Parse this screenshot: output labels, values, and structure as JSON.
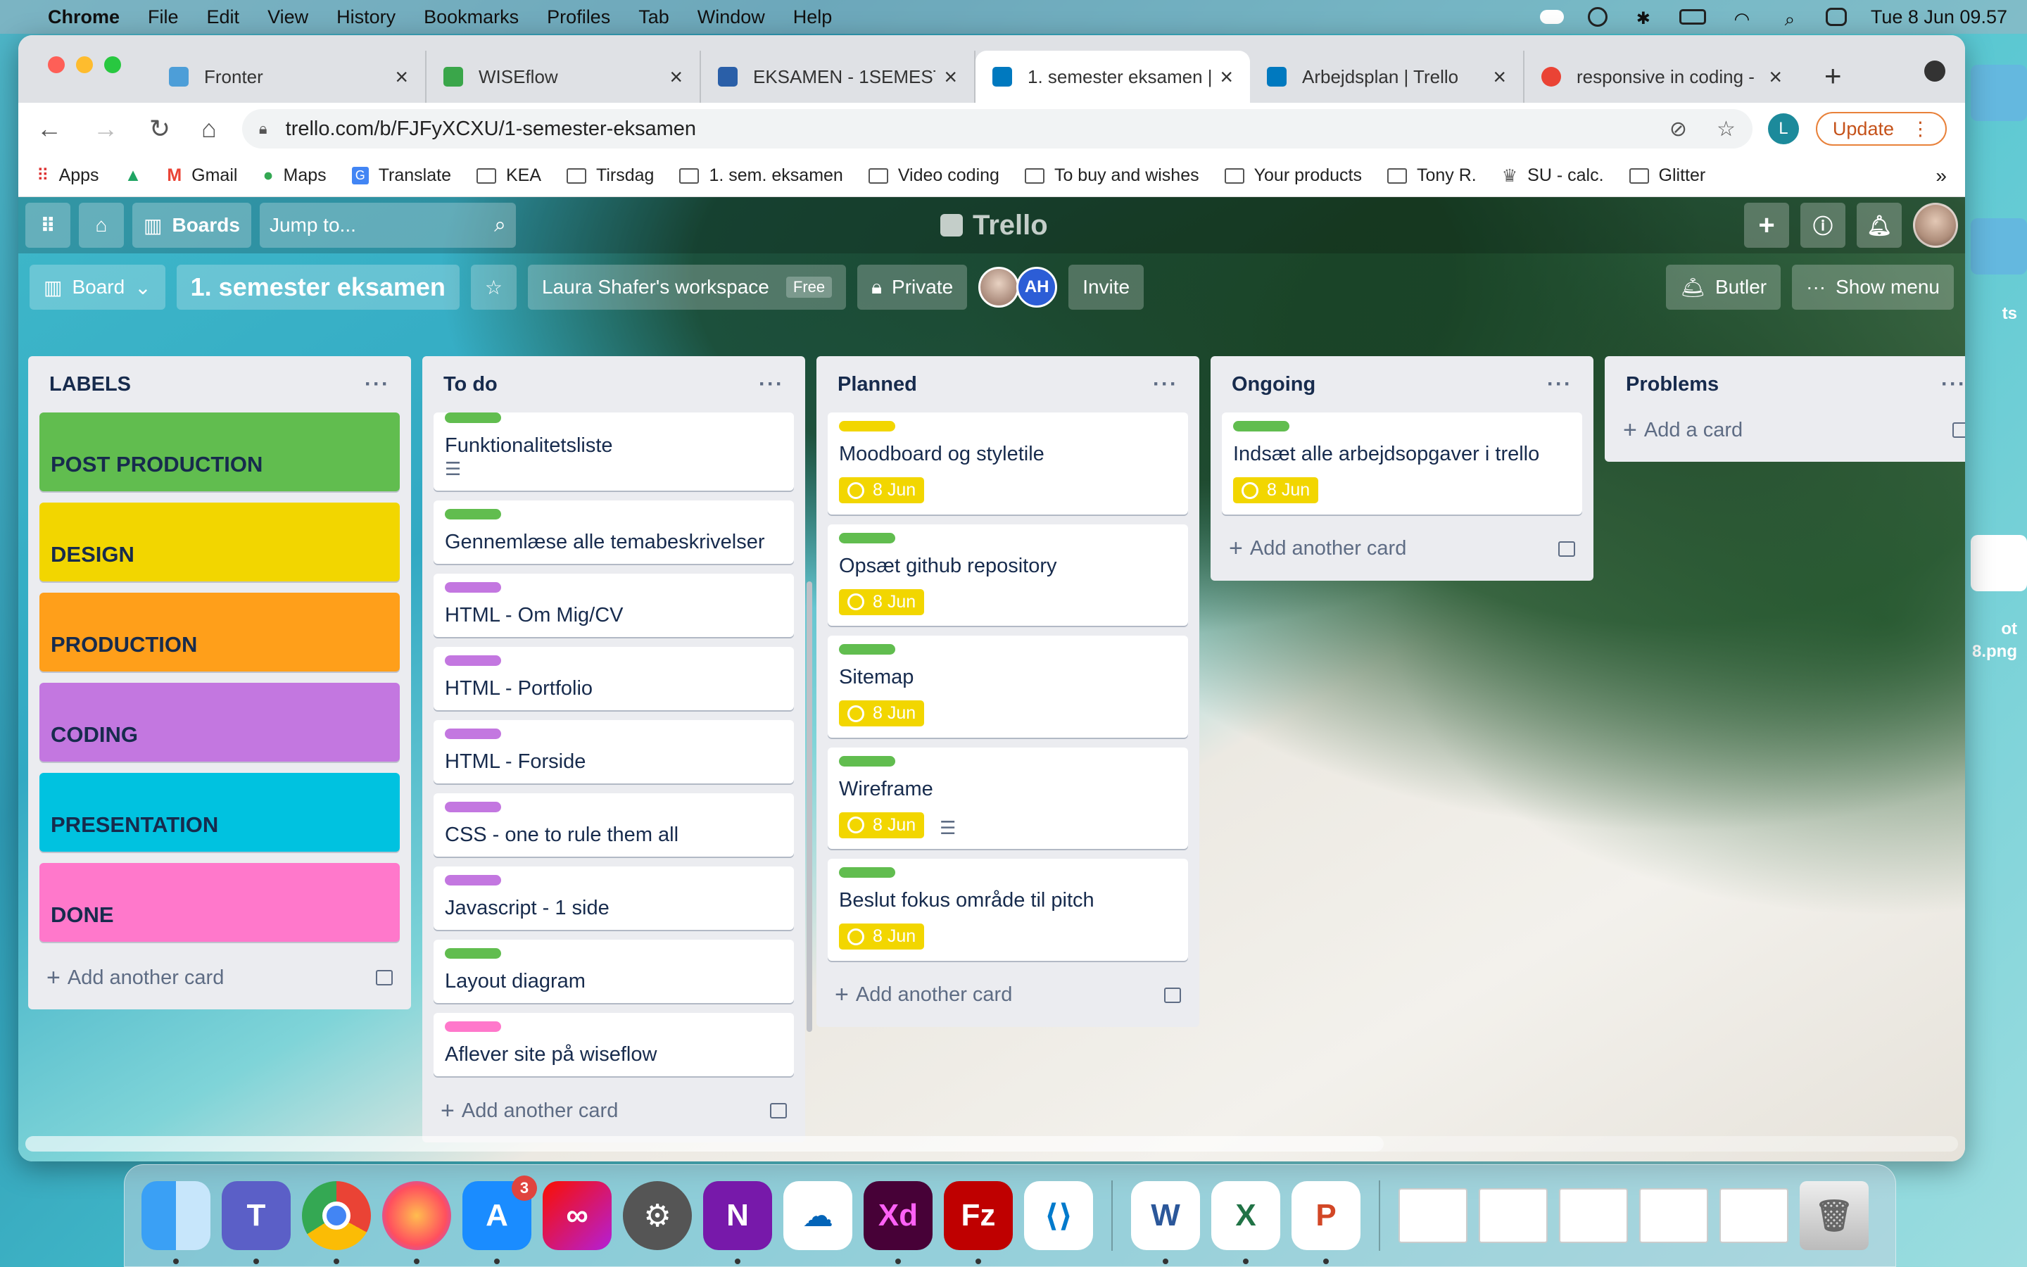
{
  "menubar": {
    "app": "Chrome",
    "items": [
      "File",
      "Edit",
      "View",
      "History",
      "Bookmarks",
      "Profiles",
      "Tab",
      "Window",
      "Help"
    ],
    "clock": "Tue 8 Jun  09.57"
  },
  "tabs": [
    {
      "title": "Fronter",
      "color": "#4d9ed8",
      "active": false
    },
    {
      "title": "WISEflow",
      "color": "#3aa64a",
      "active": false
    },
    {
      "title": "EKSAMEN - 1SEMESTE",
      "color": "#2a5fa8",
      "active": false
    },
    {
      "title": "1. semester eksamen |",
      "color": "#0079bf",
      "active": true
    },
    {
      "title": "Arbejdsplan | Trello",
      "color": "#0079bf",
      "active": false
    },
    {
      "title": "responsive in coding -",
      "color": "#ea4335",
      "active": false
    }
  ],
  "address": {
    "url": "trello.com/b/FJFyXCXU/1-semester-eksamen",
    "profile_initial": "L",
    "update_label": "Update"
  },
  "bookmarks": {
    "items": [
      "Apps",
      "Gmail",
      "Maps",
      "Translate",
      "KEA",
      "Tirsdag",
      "1. sem. eksamen",
      "Video coding",
      "To buy and wishes",
      "Your products",
      "Tony R.",
      "SU - calc.",
      "Glitter"
    ],
    "more": "»"
  },
  "trello": {
    "boards_label": "Boards",
    "jump_placeholder": "Jump to...",
    "logo": "Trello",
    "view_label": "Board",
    "board_title": "1. semester eksamen",
    "workspace": "Laura Shafer's workspace",
    "workspace_badge": "Free",
    "visibility": "Private",
    "member_initials": "AH",
    "invite": "Invite",
    "butler": "Butler",
    "show_menu": "Show menu"
  },
  "lists": {
    "labels": {
      "title": "LABELS",
      "cards": [
        {
          "text": "POST PRODUCTION",
          "color": "#61bd4f"
        },
        {
          "text": "DESIGN",
          "color": "#f2d600"
        },
        {
          "text": "PRODUCTION",
          "color": "#ff9f1a"
        },
        {
          "text": "CODING",
          "color": "#c377e0"
        },
        {
          "text": "PRESENTATION",
          "color": "#00c2e0"
        },
        {
          "text": "DONE",
          "color": "#ff78cb"
        }
      ],
      "add": "Add another card"
    },
    "todo": {
      "title": "To do",
      "cards": [
        {
          "text": "Funktionalitetsliste",
          "label": "#61bd4f",
          "desc": true
        },
        {
          "text": "Gennemlæse alle temabeskrivelser",
          "label": "#61bd4f"
        },
        {
          "text": "HTML - Om Mig/CV",
          "label": "#c377e0"
        },
        {
          "text": "HTML - Portfolio",
          "label": "#c377e0"
        },
        {
          "text": "HTML - Forside",
          "label": "#c377e0"
        },
        {
          "text": "CSS - one to rule them all",
          "label": "#c377e0"
        },
        {
          "text": "Javascript - 1 side",
          "label": "#c377e0"
        },
        {
          "text": "Layout diagram",
          "label": "#61bd4f"
        },
        {
          "text": "Aflever site på wiseflow",
          "label": "#ff78cb"
        }
      ],
      "add": "Add another card"
    },
    "planned": {
      "title": "Planned",
      "cards": [
        {
          "text": "Moodboard og styletile",
          "label": "#f2d600",
          "date": "8 Jun"
        },
        {
          "text": "Opsæt github repository",
          "label": "#61bd4f",
          "date": "8 Jun"
        },
        {
          "text": "Sitemap",
          "label": "#61bd4f",
          "date": "8 Jun"
        },
        {
          "text": "Wireframe",
          "label": "#61bd4f",
          "date": "8 Jun",
          "desc": true
        },
        {
          "text": "Beslut fokus område til pitch",
          "label": "#61bd4f",
          "date": "8 Jun"
        }
      ],
      "add": "Add another card"
    },
    "ongoing": {
      "title": "Ongoing",
      "cards": [
        {
          "text": "Indsæt alle arbejdsopgaver i trello",
          "label": "#61bd4f",
          "date": "8 Jun"
        }
      ],
      "add": "Add another card"
    },
    "problems": {
      "title": "Problems",
      "add": "Add a card"
    }
  },
  "desktop": {
    "label1": "ts",
    "label2": "ot",
    "label3": "8.png"
  },
  "dock": {
    "appstore_badge": "3"
  }
}
